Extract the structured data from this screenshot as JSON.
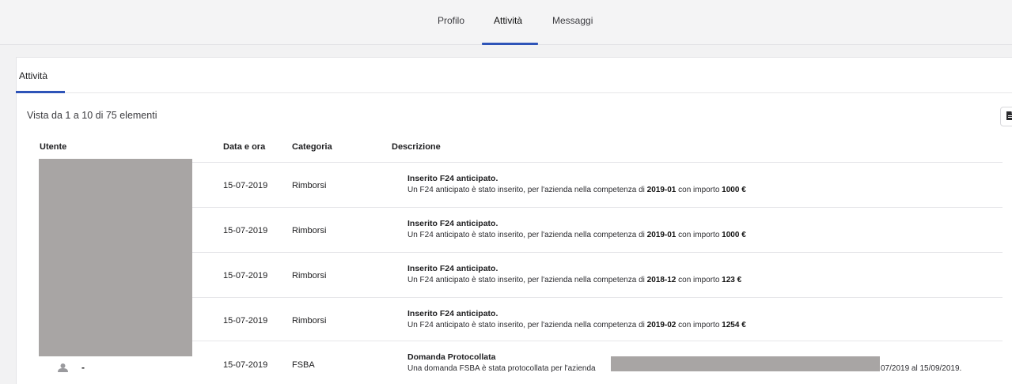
{
  "top_tabs": [
    {
      "label": "Profilo"
    },
    {
      "label": "Attività"
    },
    {
      "label": "Messaggi"
    }
  ],
  "card": {
    "tab_label": "Attività",
    "count_text": "Vista da 1 a 10 di 75 elementi",
    "export_icon": "document-icon"
  },
  "table": {
    "headers": [
      "Utente",
      "Data e ora",
      "Categoria",
      "Descrizione"
    ],
    "rows": [
      {
        "user": "",
        "date": "15-07-2019",
        "category": "Rimborsi",
        "title": "Inserito F24 anticipato.",
        "body_prefix": "Un F24 anticipato è stato inserito, per l'azienda nella competenza di ",
        "period": "2019-01",
        "body_mid": " con importo ",
        "amount": "1000 €"
      },
      {
        "user": "",
        "date": "15-07-2019",
        "category": "Rimborsi",
        "title": "Inserito F24 anticipato.",
        "body_prefix": "Un F24 anticipato è stato inserito, per l'azienda nella competenza di ",
        "period": "2019-01",
        "body_mid": " con importo ",
        "amount": "1000 €"
      },
      {
        "user": "",
        "date": "15-07-2019",
        "category": "Rimborsi",
        "title": "Inserito F24 anticipato.",
        "body_prefix": "Un F24 anticipato è stato inserito, per l'azienda nella competenza di ",
        "period": "2018-12",
        "body_mid": " con importo ",
        "amount": "123 €"
      },
      {
        "user": "",
        "date": "15-07-2019",
        "category": "Rimborsi",
        "title": "Inserito F24 anticipato.",
        "body_prefix": "Un F24 anticipato è stato inserito, per l'azienda nella competenza di ",
        "period": "2019-02",
        "body_mid": " con importo ",
        "amount": "1254 €"
      },
      {
        "user": "-",
        "user_icon": "user-icon",
        "date": "15-07-2019",
        "category": "FSBA",
        "title": "Domanda Protocollata",
        "body_prefix": "Una domanda FSBA è stata protocollata per l'azienda",
        "body_suffix": "07/2019 al 15/09/2019."
      }
    ]
  },
  "colors": {
    "accent": "#2e54b8",
    "redaction": "#a8a5a4"
  }
}
